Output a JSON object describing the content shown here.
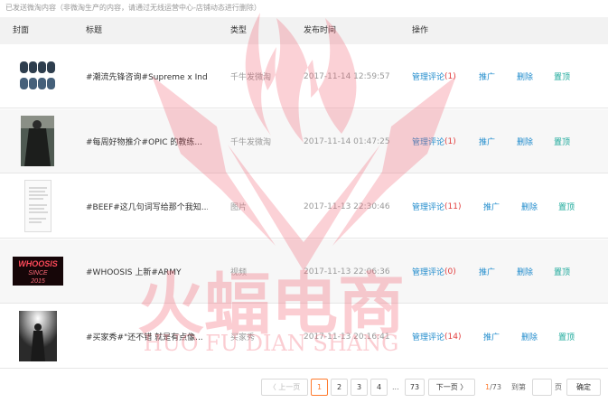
{
  "notice": "已发送微淘内容（非微淘生产的内容，请通过无线运营中心-店铺动态进行删除）",
  "columns": {
    "cover": "封面",
    "title": "标题",
    "type": "类型",
    "time": "发布时间",
    "ops": "操作"
  },
  "rows": [
    {
      "title": "#潮流先锋咨询#Supreme x Ind...",
      "type": "千牛发微淘",
      "time": "2017-11-14 12:59:57",
      "manage": "管理评论",
      "count": "(1)",
      "promote": "推广",
      "delete": "删除",
      "top": "置顶"
    },
    {
      "title": "#每周好物推介#OPIC 的教练...",
      "type": "千牛发微淘",
      "time": "2017-11-14 01:47:25",
      "manage": "管理评论",
      "count": "(1)",
      "promote": "推广",
      "delete": "删除",
      "top": "置顶"
    },
    {
      "title": "#BEEF#这几句词写给那个我知...",
      "type": "图片",
      "time": "2017-11-13 22:30:46",
      "manage": "管理评论",
      "count": "(11)",
      "promote": "推广",
      "delete": "删除",
      "top": "置顶"
    },
    {
      "title": "#WHOOSIS 上新#ARMY",
      "type": "视频",
      "time": "2017-11-13 22:06:36",
      "manage": "管理评论",
      "count": "(0)",
      "promote": "推广",
      "delete": "删除",
      "top": "置顶"
    },
    {
      "title": "#买家秀#\"还不错 就是有点像...",
      "type": "买家秀",
      "time": "2017-11-13 20:16:41",
      "manage": "管理评论",
      "count": "(14)",
      "promote": "推广",
      "delete": "删除",
      "top": "置顶"
    }
  ],
  "neon_text": {
    "line1": "WHOOSIS",
    "line2": "SINCE",
    "line3": "2015"
  },
  "watermark": {
    "cn": "火蝠电商",
    "en": "HUO FU DIAN SHANG"
  },
  "pager": {
    "prev": "〈 上一页",
    "pages": [
      "1",
      "2",
      "3",
      "4"
    ],
    "ellipsis": "...",
    "last": "73",
    "next": "下一页 〉",
    "current": "1",
    "total": "/73",
    "goto": "到第",
    "page_unit": "页",
    "confirm": "确定"
  },
  "colors": {
    "link": "#1f8bcc",
    "count": "#e23c3c",
    "top": "#1aa89a",
    "active_page": "#ff7a2e",
    "watermark": "#f25a6a"
  }
}
